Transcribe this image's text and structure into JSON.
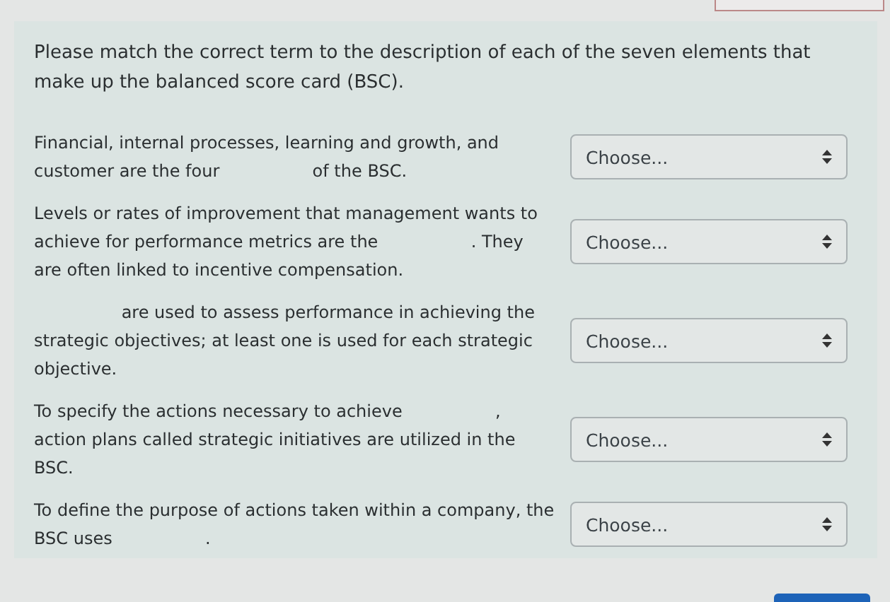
{
  "intro": "Please match the correct term to the description of each of the seven elements that make up the balanced score card (BSC).",
  "items": [
    {
      "before": "Financial, internal processes, learning and growth, and customer are the four",
      "after": "of the BSC.",
      "select": "Choose..."
    },
    {
      "before": "Levels or rates of improvement that management wants to achieve for performance metrics are the",
      "after": ". They are often linked to incentive compensation.",
      "select": "Choose..."
    },
    {
      "after": "are used to assess performance in achieving the strategic objectives; at least one is used for each strategic objective.",
      "select": "Choose..."
    },
    {
      "before": "To specify the actions necessary to achieve",
      "after": ", action plans called strategic initiatives are utilized in the BSC.",
      "select": "Choose..."
    },
    {
      "before": "To define the purpose of actions taken within a company, the BSC uses",
      "after": ".",
      "select": "Choose..."
    }
  ]
}
